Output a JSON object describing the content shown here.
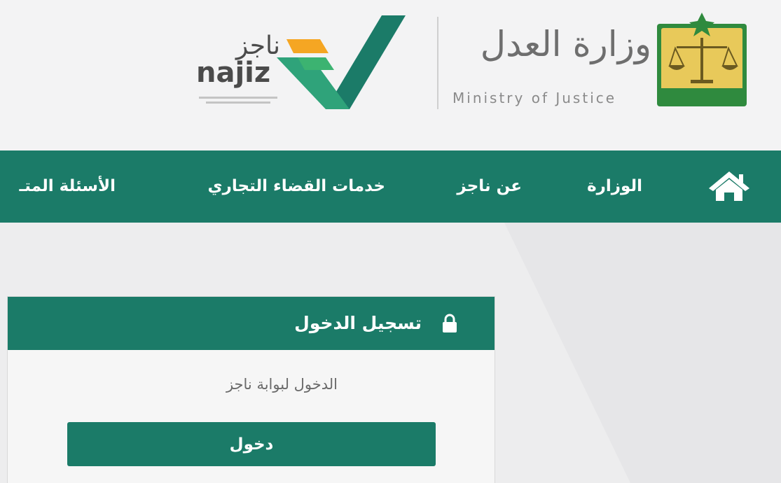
{
  "header": {
    "ministry_name_ar": "وزارة العدل",
    "ministry_name_en": "Ministry of Justice",
    "najiz_name_ar": "ناجز",
    "najiz_name_en": "najiz"
  },
  "nav": {
    "items": [
      {
        "label": "الوزارة"
      },
      {
        "label": "عن ناجز"
      },
      {
        "label": "خدمات القضاء التجاري"
      },
      {
        "label": "الأسئلة المتـ"
      }
    ]
  },
  "login": {
    "title": "تسجيل الدخول",
    "subtitle": "الدخول لبوابة ناجز",
    "button_label": "دخول"
  },
  "icons": {
    "home": "home-icon",
    "lock": "lock-icon"
  },
  "colors": {
    "brand_green": "#1b7b68",
    "accent_orange": "#f5a623",
    "mark_green": "#2fa37a",
    "emblem_gold": "#d8b54a"
  }
}
